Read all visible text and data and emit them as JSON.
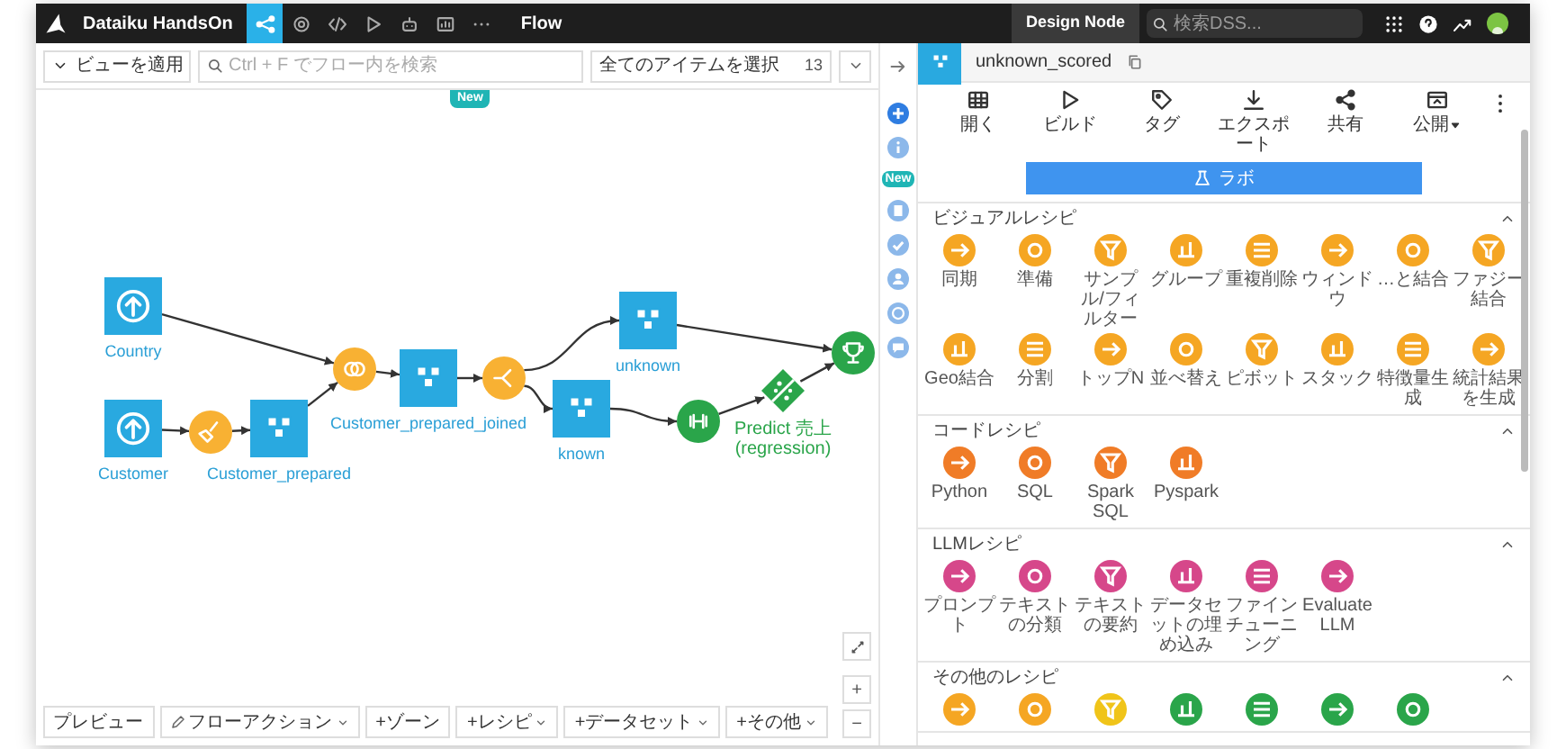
{
  "top_bar": {
    "project": "Dataiku HandsOn",
    "nav": [
      {
        "kind": "flow",
        "selected": true
      },
      {
        "kind": "recipes",
        "selected": false
      },
      {
        "kind": "code",
        "selected": false
      },
      {
        "kind": "jobs",
        "selected": false
      },
      {
        "kind": "ml",
        "selected": false
      },
      {
        "kind": "dashboards",
        "selected": false
      },
      {
        "kind": "more",
        "selected": false
      }
    ],
    "page": "Flow",
    "node": "Design Node",
    "search": {
      "placeholder": "検索DSS..."
    }
  },
  "flow_toolbar": {
    "view": "ビューを適用",
    "search": {
      "placeholder": "Ctrl + F でフロー内を検索"
    },
    "select": "全てのアイテムを選択",
    "count": "13",
    "new_badge": "New"
  },
  "side_rail": {
    "new_badge": "New"
  },
  "flow": {
    "nodes": [
      {
        "kind": "uploaded_dataset",
        "label": "Country"
      },
      {
        "kind": "uploaded_dataset",
        "label": "Customer"
      },
      {
        "kind": "prepare_recipe"
      },
      {
        "kind": "dataset",
        "label": "Customer_prepared"
      },
      {
        "kind": "join_recipe"
      },
      {
        "kind": "dataset",
        "label": "Customer_prepared_joined"
      },
      {
        "kind": "split_recipe"
      },
      {
        "kind": "dataset",
        "label": "unknown"
      },
      {
        "kind": "dataset",
        "label": "known"
      },
      {
        "kind": "train_recipe"
      },
      {
        "kind": "model",
        "label": "Predict 売上 (regression)"
      },
      {
        "kind": "score_recipe"
      }
    ]
  },
  "flow_actions": [
    {
      "kind": "preview",
      "label": "プレビュー",
      "dropdown": false
    },
    {
      "kind": "actions",
      "label": "フローアクション",
      "dropdown": true
    },
    {
      "kind": "add",
      "label": "+ゾーン",
      "dropdown": false
    },
    {
      "kind": "add",
      "label": "+レシピ",
      "dropdown": true
    },
    {
      "kind": "add",
      "label": "+データセット",
      "dropdown": true
    },
    {
      "kind": "add",
      "label": "+その他",
      "dropdown": true
    }
  ],
  "zoom_controls": [
    "+",
    "−"
  ],
  "panel": {
    "title": "unknown_scored",
    "actions": [
      {
        "kind": "open",
        "label": "開く",
        "dropdown": false
      },
      {
        "kind": "build",
        "label": "ビルド",
        "dropdown": false
      },
      {
        "kind": "tag",
        "label": "タグ",
        "dropdown": false
      },
      {
        "kind": "export",
        "label": "エクスポート",
        "dropdown": false
      },
      {
        "kind": "share",
        "label": "共有",
        "dropdown": false
      },
      {
        "kind": "publish",
        "label": "公開",
        "dropdown": true
      },
      {
        "kind": "more"
      }
    ],
    "lab_button": "ラボ",
    "sections": [
      {
        "kind": "visual",
        "title": "ビジュアルレシピ",
        "expanded": true,
        "items": [
          "同期",
          "準備",
          "サンプル/フィルター",
          "グループ",
          "重複削除",
          "ウィンドウ",
          "…と結合",
          "ファジー結合",
          "Geo結合",
          "分割",
          "トップN",
          "並べ替え",
          "ピボット",
          "スタック",
          "特徴量生成",
          "統計結果を生成"
        ]
      },
      {
        "kind": "code",
        "title": "コードレシピ",
        "expanded": true,
        "items": [
          "Python",
          "SQL",
          "Spark SQL",
          "Pyspark"
        ]
      },
      {
        "kind": "llm",
        "title": "LLMレシピ",
        "expanded": true,
        "items": [
          "プロンプト",
          "テキストの分類",
          "テキストの要約",
          "データセットの埋め込み",
          "ファインチューニング",
          "Evaluate LLM"
        ]
      },
      {
        "kind": "other",
        "title": "その他のレシピ",
        "expanded": true,
        "items": [
          {
            "color": "#f5a623"
          },
          {
            "color": "#f5a623"
          },
          {
            "color": "#f0c419"
          },
          {
            "color": "#2aa54a"
          },
          {
            "color": "#2aa54a"
          },
          {
            "color": "#2aa54a"
          },
          {
            "color": "#2aa54a"
          }
        ]
      }
    ]
  }
}
